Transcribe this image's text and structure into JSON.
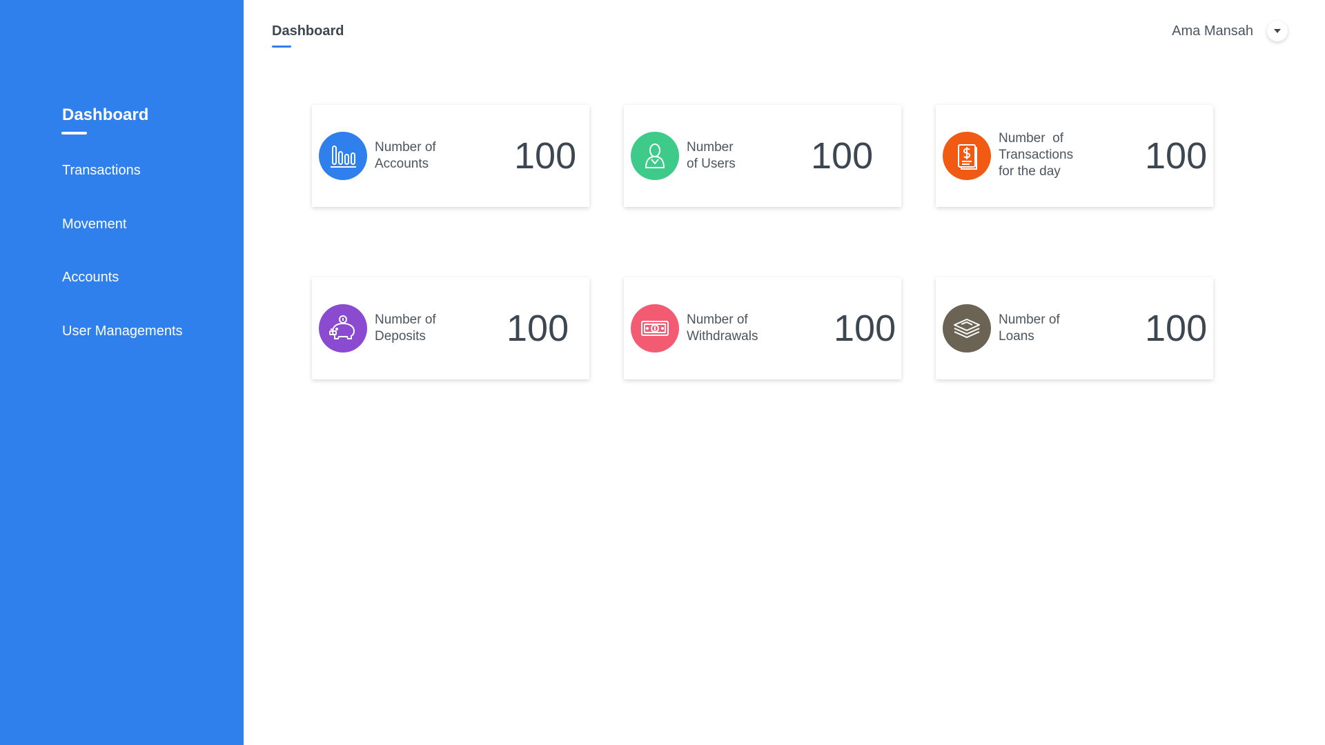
{
  "sidebar": {
    "items": [
      {
        "label": "Dashboard",
        "active": true
      },
      {
        "label": "Transactions"
      },
      {
        "label": "Movement"
      },
      {
        "label": "Accounts"
      },
      {
        "label": "User Managements"
      }
    ]
  },
  "header": {
    "title": "Dashboard",
    "user_name": "Ama Mansah"
  },
  "colors": {
    "sidebar": "#2f80ed",
    "accounts_icon": "#2f80ed",
    "users_icon": "#3ecb8a",
    "transactions_icon": "#f05a12",
    "deposits_icon": "#8a4bd1",
    "withdrawals_icon": "#f35b72",
    "loans_icon": "#6b6354"
  },
  "cards": [
    {
      "label_lines": [
        "Number of",
        "Accounts"
      ],
      "value": "100",
      "icon": "bar-chart-icon"
    },
    {
      "label_lines": [
        "Number",
        "of Users"
      ],
      "value": "100",
      "icon": "user-icon"
    },
    {
      "label_lines": [
        "Number  of",
        "Transactions",
        "for the day"
      ],
      "value": "100",
      "icon": "receipt-dollar-icon"
    },
    {
      "label_lines": [
        "Number of",
        "Deposits"
      ],
      "value": "100",
      "icon": "piggy-bank-icon"
    },
    {
      "label_lines": [
        "Number of",
        "Withdrawals"
      ],
      "value": "100",
      "icon": "banknote-icon"
    },
    {
      "label_lines": [
        "Number of",
        "Loans"
      ],
      "value": "100",
      "icon": "money-stack-icon"
    }
  ]
}
